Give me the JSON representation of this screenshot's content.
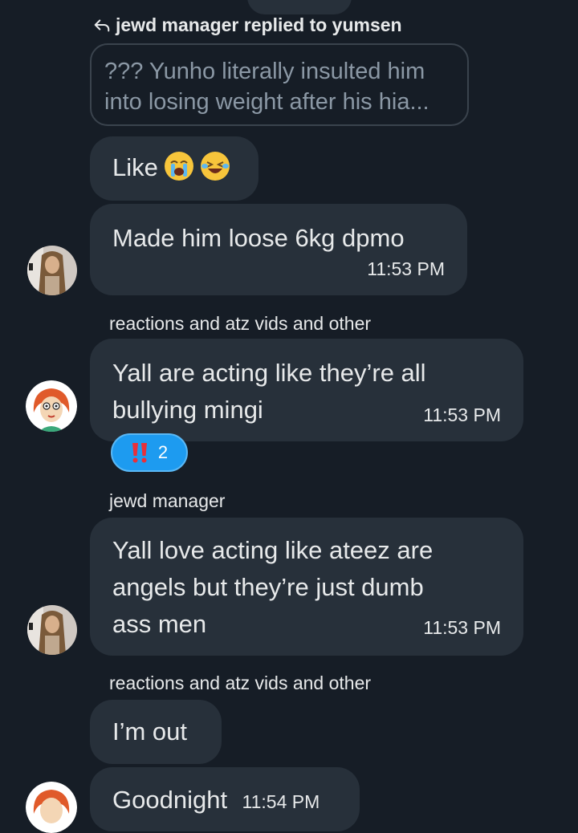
{
  "reply_context": {
    "text": "jewd manager replied to yumsen",
    "quoted": "??? Yunho literally insulted him into losing weight after his hia..."
  },
  "messages": [
    {
      "text": "Like",
      "emojis": [
        "crying-face-emoji",
        "laughing-tears-emoji"
      ]
    },
    {
      "text": "Made him loose 6kg dpmo",
      "time": "11:53 PM"
    },
    {
      "sender": "reactions and atz vids and other",
      "text_line1": "Yall are acting like they’re  all",
      "text_line2": "bullying mingi",
      "time": "11:53 PM"
    },
    {
      "reaction": {
        "icon": "double-exclamation-emoji",
        "count": "2"
      }
    },
    {
      "sender": "jewd manager",
      "text_line1": "Yall love acting like ateez are",
      "text_line2": "angels but they’re just dumb",
      "text_line3": "ass men",
      "time": "11:53 PM"
    },
    {
      "sender": "reactions and atz vids and other",
      "text": "I’m out"
    },
    {
      "text": "Goodnight",
      "time": "11:54 PM"
    }
  ],
  "colors": {
    "background": "#161d26",
    "bubble": "#27303a",
    "reaction": "#1d9bf0"
  }
}
